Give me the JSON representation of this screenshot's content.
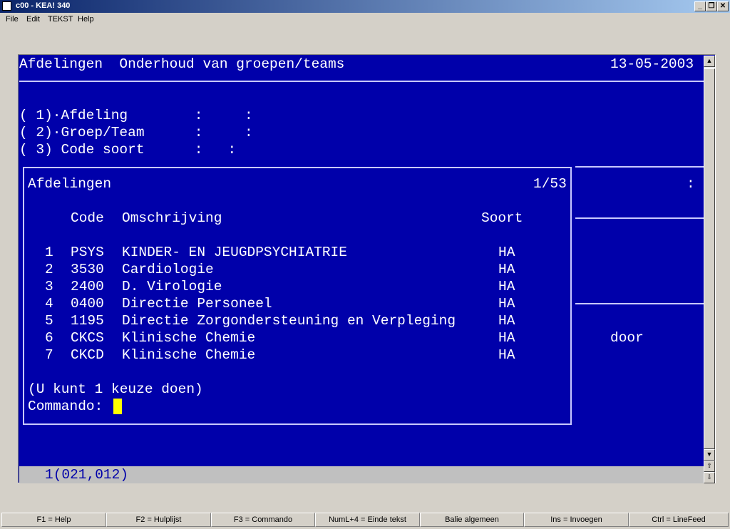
{
  "window": {
    "title": "c00 - KEA! 340"
  },
  "menu": [
    "File",
    "Edit",
    "TEKST",
    "Help"
  ],
  "screen": {
    "header": "Afdelingen  Onderhoud van groepen/teams",
    "date": "13-05-2003",
    "fields": [
      "( 1)·Afdeling        :     :",
      "( 2)·Groep/Team      :     :",
      "( 3) Code soort      :   :"
    ],
    "side_colon": ":",
    "side_text": "door",
    "popup": {
      "title": "Afdelingen",
      "page": "1/53",
      "col_code": "Code",
      "col_desc": "Omschrijving",
      "col_soort": "Soort",
      "rows": [
        {
          "num": "1",
          "code": "PSYS",
          "desc": "KINDER- EN JEUGDPSYCHIATRIE",
          "soort": "HA"
        },
        {
          "num": "2",
          "code": "3530",
          "desc": "Cardiologie",
          "soort": "HA"
        },
        {
          "num": "3",
          "code": "2400",
          "desc": "D. Virologie",
          "soort": "HA"
        },
        {
          "num": "4",
          "code": "0400",
          "desc": "Directie Personeel",
          "soort": "HA"
        },
        {
          "num": "5",
          "code": "1195",
          "desc": "Directie Zorgondersteuning en Verpleging",
          "soort": "HA"
        },
        {
          "num": "6",
          "code": "CKCS",
          "desc": "Klinische Chemie",
          "soort": "HA"
        },
        {
          "num": "7",
          "code": "CKCD",
          "desc": "Klinische Chemie",
          "soort": "HA"
        }
      ],
      "hint": "(U kunt 1 keuze doen)",
      "command_label": "Commando:"
    },
    "status": "1(021,012)"
  },
  "fkeys": [
    "F1 = Help",
    "F2 = Hulplijst",
    "F3 = Commando",
    "NumL+4 = Einde tekst",
    "Balie algemeen",
    "Ins = Invoegen",
    "Ctrl = LineFeed"
  ]
}
